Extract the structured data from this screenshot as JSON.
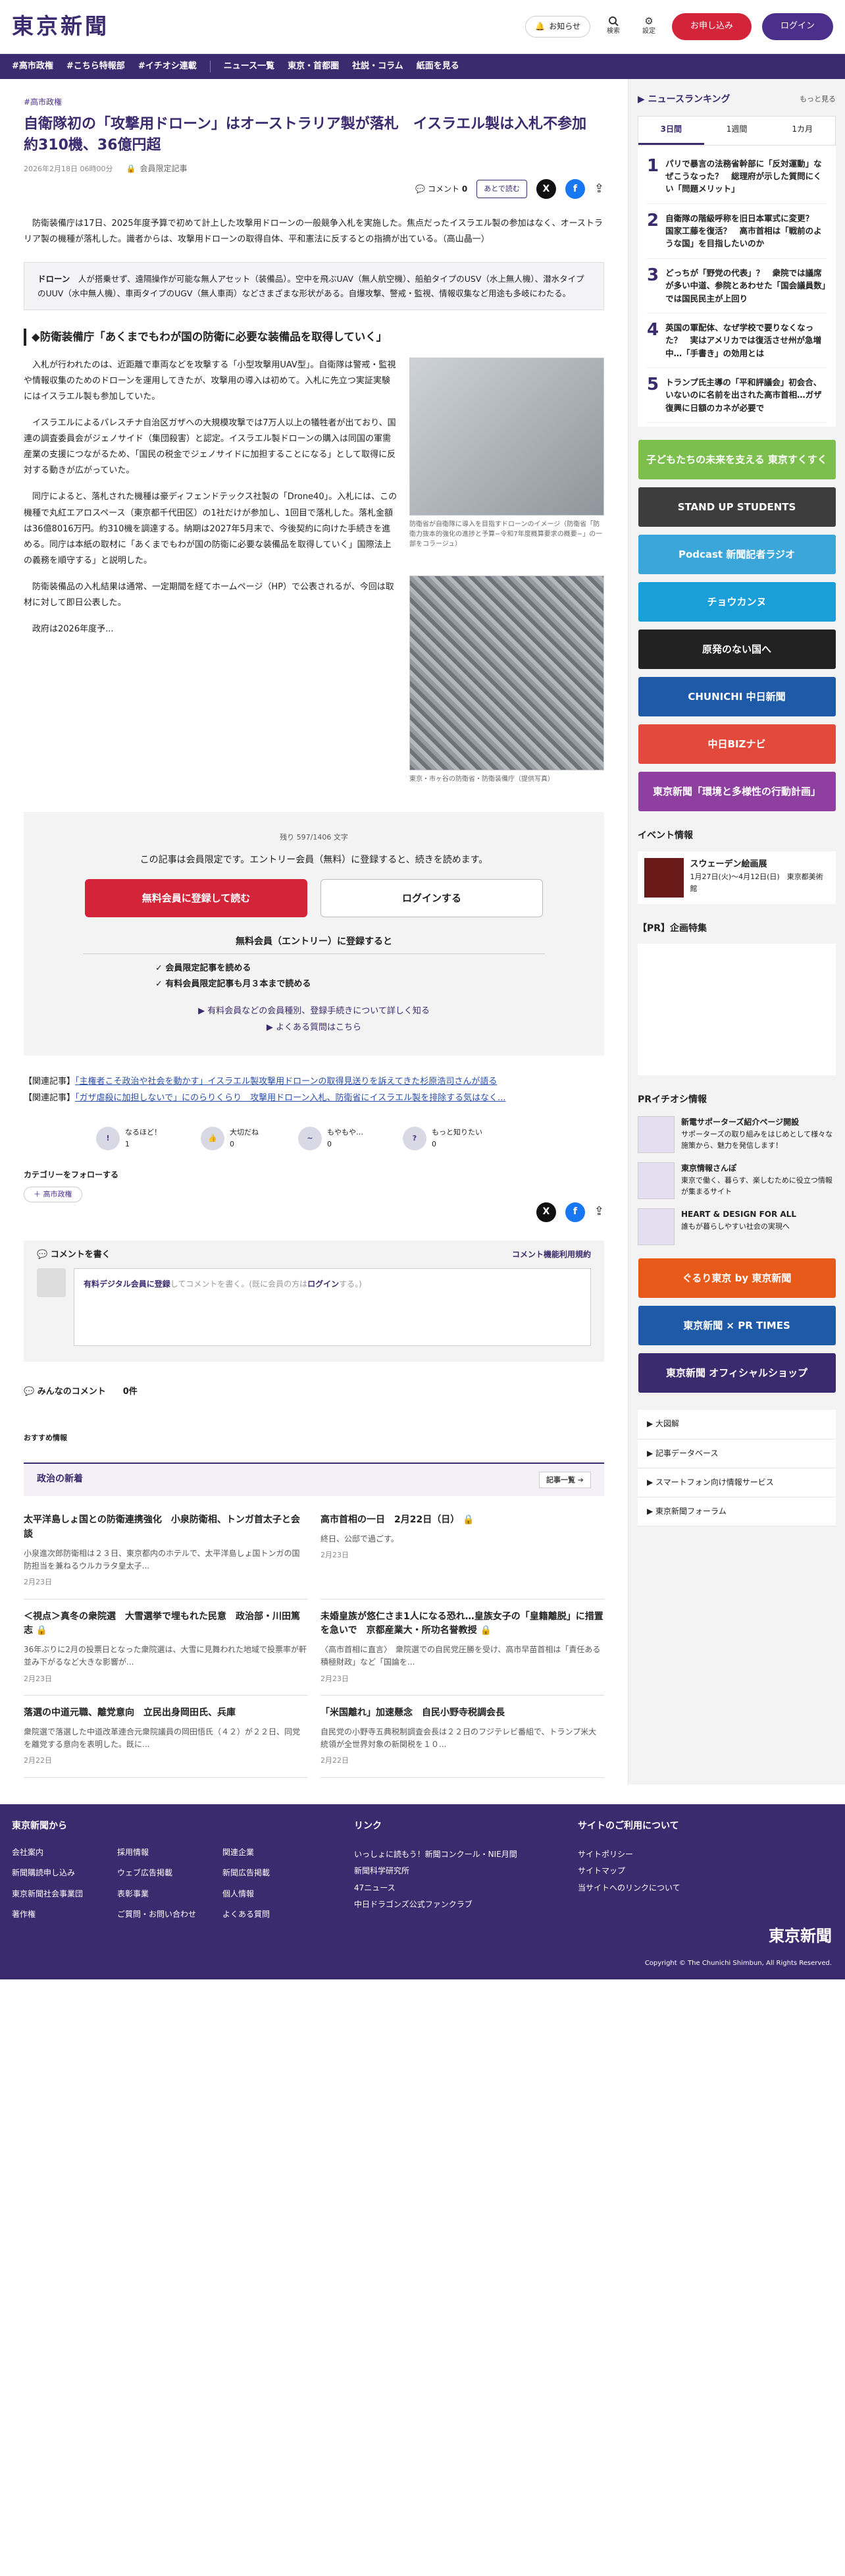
{
  "header": {
    "logo": "東京新聞",
    "notice": "お知らせ",
    "search": "検索",
    "settings": "設定",
    "register": "お申し込み",
    "login": "ログイン"
  },
  "nav": [
    "#高市政権",
    "#こちら特報部",
    "#イチオシ連載",
    "ニュース一覧",
    "東京・首都圏",
    "社説・コラム",
    "紙面を見る"
  ],
  "article": {
    "category": "#高市政権",
    "title": "自衛隊初の「攻撃用ドローン」はオーストラリア製が落札　イスラエル製は入札不参加　約310機、36億円超",
    "date": "2026年2月18日 06時00分",
    "members_badge": "会員限定記事",
    "comment_label": "コメント",
    "comment_count": "0",
    "read_later": "あとで読む",
    "lead": "防衛装備庁は17日、2025年度予算で初めて計上した攻撃用ドローンの一般競争入札を実施した。焦点だったイスラエル製の参加はなく、オーストラリア製の機種が落札した。識者からは、攻撃用ドローンの取得自体、平和憲法に反するとの指摘が出ている。（高山晶一）",
    "glossary_term": "ドローン",
    "glossary": "人が搭乗せず、遠隔操作が可能な無人アセット（装備品）。空中を飛ぶUAV（無人航空機）、船舶タイプのUSV（水上無人機）、潜水タイプのUUV（水中無人機）、車両タイプのUGV（無人車両）などさまざまな形状がある。自爆攻撃、警戒・監視、情報収集など用途も多岐にわたる。",
    "subhead": "◆防衛装備庁「あくまでもわが国の防衛に必要な装備品を取得していく」",
    "paragraphs": [
      "入札が行われたのは、近距離で車両などを攻撃する「小型攻撃用UAV型」。自衛隊は警戒・監視や情報収集のためのドローンを運用してきたが、攻撃用の導入は初めて。入札に先立つ実証実験にはイスラエル製も参加していた。",
      "イスラエルによるパレスチナ自治区ガザへの大規模攻撃では7万人以上の犠牲者が出ており、国連の調査委員会がジェノサイド（集団殺害）と認定。イスラエル製ドローンの購入は同国の軍需産業の支援につながるため、「国民の税金でジェノサイドに加担することになる」として取得に反対する動きが広がっていた。",
      "同庁によると、落札された機種は豪ディフェンドテックス社製の「Drone40」。入札には、この機種で丸紅エアロスペース（東京都千代田区）の1社だけが参加し、1回目で落札した。落札金額は36億8016万円。約310機を調達する。納期は2027年5月末で、今後契約に向けた手続きを進める。同庁は本紙の取材に「あくまでもわが国の防衛に必要な装備品を取得していく」国際法上の義務を順守する」と説明した。",
      "防衛装備品の入札結果は通常、一定期間を経てホームページ（HP）で公表されるが、今回は取材に対して即日公表した。",
      "政府は2026年度予..."
    ],
    "fig1_caption": "防衛省が自衛隊に導入を目指すドローンのイメージ（防衛省「防衛力抜本的強化の進捗と予算−令和7年度概算要求の概要−」の一部をコラージュ）",
    "fig2_caption": "東京・市ヶ谷の防衛省・防衛装備庁（提供写真）"
  },
  "paywall": {
    "remaining": "残り 597/1406 文字",
    "message": "この記事は会員限定です。エントリー会員（無料）に登録すると、続きを読めます。",
    "register_btn": "無料会員に登録して読む",
    "login_btn": "ログインする",
    "benefit_title": "無料会員（エントリー）に登録すると",
    "benefits": [
      "✓ 会員限定記事を読める",
      "✓ 有料会員限定記事も月３本まで読める"
    ],
    "link1": "▶ 有料会員などの会員種別、登録手続きについて詳しく知る",
    "link2": "▶ よくある質問はこちら"
  },
  "related": [
    {
      "prefix": "【関連記事】",
      "text": "「主権者こそ政治や社会を動かす」イスラエル製攻撃用ドローンの取得見送りを訴えてきた杉原浩司さんが語る"
    },
    {
      "prefix": "【関連記事】",
      "text": "「ガザ虐殺に加担しないで」にのらりくらり　攻撃用ドローン入札、防衛省にイスラエル製を排除する気はなく..."
    }
  ],
  "reactions": [
    {
      "label": "なるほど！",
      "count": "1"
    },
    {
      "label": "大切だね",
      "count": "0"
    },
    {
      "label": "もやもや…",
      "count": "0"
    },
    {
      "label": "もっと知りたい",
      "count": "0"
    }
  ],
  "follow": {
    "title": "カテゴリーをフォローする",
    "tag": "高市政権"
  },
  "comments": {
    "write": "コメントを書く",
    "rules": "コメント機能利用規約",
    "prompt_link": "有料デジタル会員に登録",
    "prompt_text": "してコメントを書く。(既に会員の方は",
    "prompt_login": "ログイン",
    "prompt_end": "する。)",
    "all": "みんなのコメント",
    "all_count": "0件"
  },
  "recommend": "おすすめ情報",
  "politics": {
    "title": "政治の新着",
    "more": "記事一覧",
    "items": [
      {
        "t": "太平洋島しょ国との防衛連携強化　小泉防衛相、トンガ首太子と会談",
        "s": "小泉進次郎防衛相は２３日、東京都内のホテルで、太平洋島しょ国トンガの国防担当を兼ねるウルカラタ皇太子...",
        "d": "2月23日"
      },
      {
        "t": "高市首相の一日　2月22日（日）",
        "s": "終日、公邸で過ごす。",
        "d": "2月23日"
      },
      {
        "t": "＜視点＞真冬の衆院選　大雪選挙で埋もれた民意　政治部・川田篤志",
        "s": "36年ぶりに2月の投票日となった衆院選は、大雪に見舞われた地域で投票率が軒並み下がるなど大きな影響が...",
        "d": "2月23日"
      },
      {
        "t": "未婚皇族が悠仁さま1人になる恐れ…皇族女子の「皇籍離脱」に措置を急いで　京都産業大・所功名誉教授",
        "s": "〈高市首相に直言〉　衆院選での自民党圧勝を受け、高市早苗首相は「責任ある積極財政」など「国論を...",
        "d": "2月23日"
      },
      {
        "t": "落選の中道元職、離党意向　立民出身岡田氏、兵庫",
        "s": "衆院選で落選した中道改革連合元衆院議員の岡田悟氏（４２）が２２日、同党を離党する意向を表明した。既に...",
        "d": "2月22日"
      },
      {
        "t": "「米国離れ」加速懸念　自民小野寺税調会長",
        "s": "自民党の小野寺五典税制調査会長は２２日のフジテレビ番組で、トランプ米大統領が全世界対象の新関税を１０...",
        "d": "2月22日"
      }
    ]
  },
  "ranking": {
    "title": "ニュースランキング",
    "more": "もっと見る",
    "tabs": [
      "3日間",
      "1週間",
      "1カ月"
    ],
    "items": [
      {
        "n": "1",
        "t": "パリで暴言の法務省幹部に「反対運動」なぜこうなった？　総理府が示した質問にくい「問題メリット」"
      },
      {
        "n": "2",
        "t": "自衛隊の階級呼称を旧日本軍式に変更？　国家工藤を復活？　高市首相は「戦前のような国」を目指したいのか"
      },
      {
        "n": "3",
        "t": "どっちが「野党の代表」？　衆院では議席が多い中道、参院とあわせた「国会議員数」では国民民主が上回り"
      },
      {
        "n": "4",
        "t": "英国の軍配体、なぜ学校で要りなくなった？　実はアメリカでは復活させ州が急増中…「手書き」の効用とは"
      },
      {
        "n": "5",
        "t": "トランプ氏主導の「平和評議会」初会合、いないのに名前を出された高市首相…ガザ復興に日額のカネが必要で"
      }
    ]
  },
  "banners": [
    {
      "text": "子どもたちの未来を支える 東京すくすく",
      "color": "#7dbf4d"
    },
    {
      "text": "STAND UP STUDENTS",
      "color": "#3d3d3d"
    },
    {
      "text": "Podcast 新聞記者ラジオ",
      "color": "#3aa6d9"
    },
    {
      "text": "チョウカンヌ",
      "color": "#1a9fd8"
    },
    {
      "text": "原発のない国へ",
      "color": "#222222"
    },
    {
      "text": "CHUNICHI 中日新聞",
      "color": "#1e5aa8"
    },
    {
      "text": "中日BIZナビ",
      "color": "#e34a3c"
    },
    {
      "text": "東京新聞「環境と多様性の行動計画」",
      "color": "#8e3fa0"
    }
  ],
  "event": {
    "title": "イベント情報",
    "name": "スウェーデン絵画展",
    "info": "1月27日(火)〜4月12日(日)　東京都美術館"
  },
  "pr": {
    "title": "【PR】企画特集",
    "title2": "PRイチオシ情報",
    "items": [
      {
        "t": "新電サポーターズ紹介ページ開設",
        "s": "サポーターズの取り組みをはじめとして様々な施策から、魅力を発信します！"
      },
      {
        "t": "東京情報さんぽ",
        "s": "東京で働く、暮らす、楽しむために役立つ情報が集まるサイト"
      },
      {
        "t": "HEART & DESIGN FOR ALL",
        "s": "誰もが暮らしやすい社会の実現へ"
      }
    ]
  },
  "side_banners2": [
    {
      "text": "ぐるり東京 by 東京新聞",
      "color": "#e85a1a"
    },
    {
      "text": "東京新聞 × PR TIMES",
      "color": "#1e5aa8"
    },
    {
      "text": "東京新聞 オフィシャルショップ",
      "color": "#3a2a6e"
    }
  ],
  "side_links": [
    "大図解",
    "記事データベース",
    "スマートフォン向け情報サービス",
    "東京新聞フォーラム"
  ],
  "footer": {
    "col1_title": "東京新聞から",
    "col1": [
      "会社案内",
      "採用情報",
      "関連企業",
      "新聞購読申し込み",
      "ウェブ広告掲載",
      "新聞広告掲載",
      "東京新聞社会事業団",
      "表彰事業",
      "個人情報",
      "著作権",
      "ご質問・お問い合わせ",
      "よくある質問"
    ],
    "col2_title": "リンク",
    "col2": [
      "いっしょに読もう！新聞コンクール・NIE月間",
      "新聞科学研究所",
      "47ニュース",
      "中日ドラゴンズ公式ファンクラブ"
    ],
    "col3_title": "サイトのご利用について",
    "col3": [
      "サイトポリシー",
      "サイトマップ",
      "当サイトへのリンクについて"
    ],
    "logo": "東京新聞",
    "copy": "Copyright © The Chunichi Shimbun, All Rights Reserved."
  }
}
